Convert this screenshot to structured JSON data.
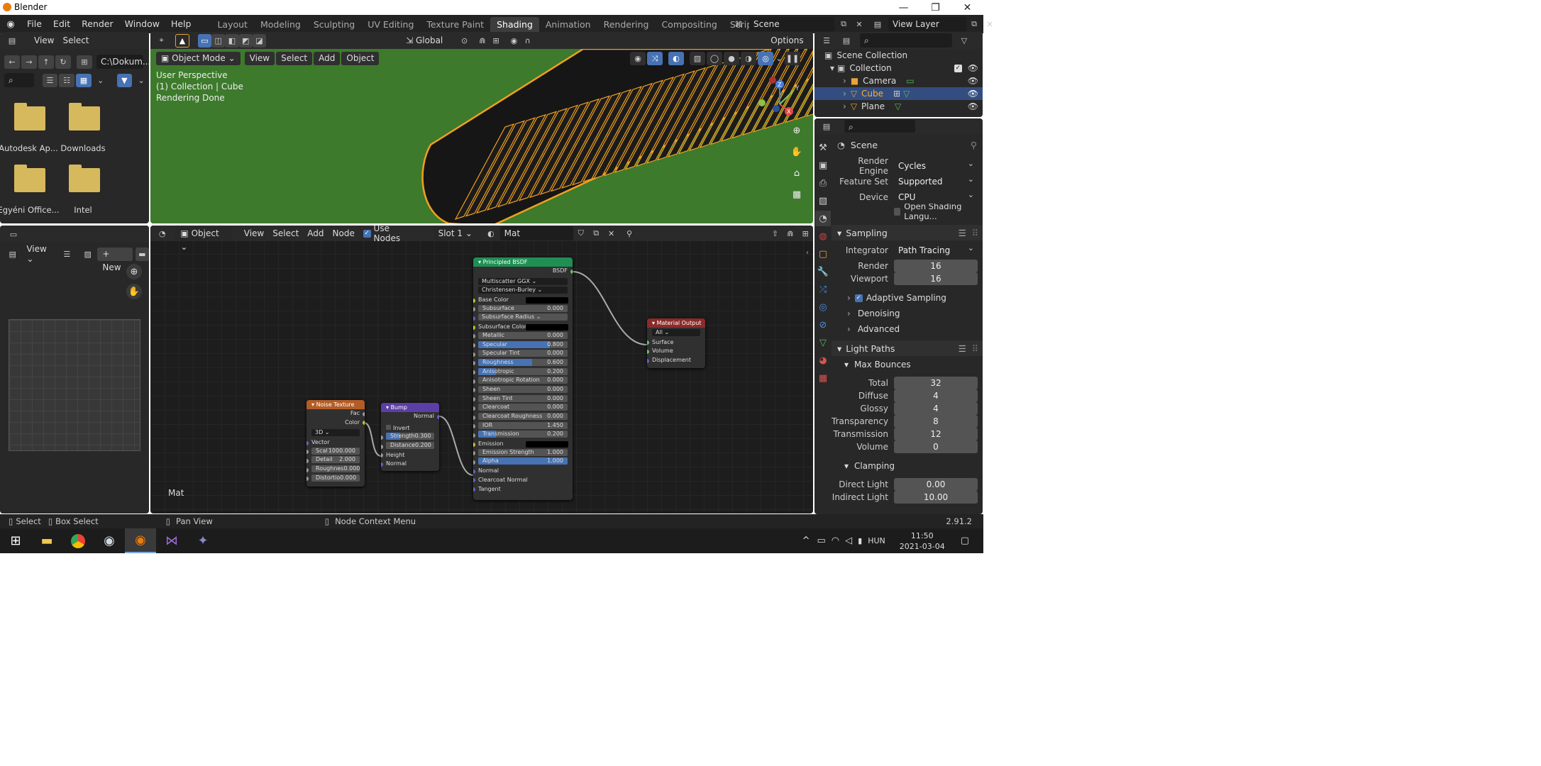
{
  "window": {
    "title": "Blender",
    "minimize": "—",
    "maximize": "❐",
    "close": "✕"
  },
  "topbar": {
    "menus": [
      "File",
      "Edit",
      "Render",
      "Window",
      "Help"
    ],
    "workspaces": [
      "Layout",
      "Modeling",
      "Sculpting",
      "UV Editing",
      "Texture Paint",
      "Shading",
      "Animation",
      "Rendering",
      "Compositing",
      "Scripting"
    ],
    "active_workspace": "Shading",
    "add_tab": "+",
    "scene": "Scene",
    "view_layer": "View Layer"
  },
  "file_browser": {
    "menus": [
      "View",
      "Select"
    ],
    "path": "C:\\Dokum...",
    "folders": [
      {
        "name": "Autodesk Ap..."
      },
      {
        "name": "Downloads"
      },
      {
        "name": "Egyéni Office..."
      },
      {
        "name": "Intel"
      }
    ]
  },
  "viewport": {
    "mode": "Object Mode",
    "menus": [
      "View",
      "Select",
      "Add",
      "Object"
    ],
    "transform": "Global",
    "options": "Options",
    "overlay_lines": [
      "User Perspective",
      "(1) Collection | Cube",
      "Rendering Done"
    ],
    "gizmo": {
      "x": "X",
      "y": "Y",
      "z": "Z"
    }
  },
  "image_editor": {
    "view": "View",
    "new": "New"
  },
  "node_editor": {
    "type": "Object",
    "menus": [
      "View",
      "Select",
      "Add",
      "Node"
    ],
    "use_nodes": "Use Nodes",
    "slot": "Slot 1",
    "material": "Mat",
    "corner_label": "Mat",
    "principled": {
      "title": "Principled BSDF",
      "output": "BSDF",
      "dist": "Multiscatter GGX",
      "sss_method": "Christensen-Burley",
      "base_color": "Base Color",
      "rows": [
        {
          "label": "Subsurface",
          "value": "0.000",
          "fill": 0
        },
        {
          "label": "Subsurface Radius",
          "value": "",
          "fill": 0,
          "drop": true
        },
        {
          "label": "Subsurface Color",
          "value": "",
          "fill": 0,
          "color": true
        },
        {
          "label": "Metallic",
          "value": "0.000",
          "fill": 0
        },
        {
          "label": "Specular",
          "value": "0.800",
          "fill": 0.8
        },
        {
          "label": "Specular Tint",
          "value": "0.000",
          "fill": 0
        },
        {
          "label": "Roughness",
          "value": "0.600",
          "fill": 0.6
        },
        {
          "label": "Anisotropic",
          "value": "0.200",
          "fill": 0.2
        },
        {
          "label": "Anisotropic Rotation",
          "value": "0.000",
          "fill": 0
        },
        {
          "label": "Sheen",
          "value": "0.000",
          "fill": 0
        },
        {
          "label": "Sheen Tint",
          "value": "0.000",
          "fill": 0
        },
        {
          "label": "Clearcoat",
          "value": "0.000",
          "fill": 0
        },
        {
          "label": "Clearcoat Roughness",
          "value": "0.000",
          "fill": 0
        },
        {
          "label": "IOR",
          "value": "1.450",
          "fill": 0
        },
        {
          "label": "Transmission",
          "value": "0.200",
          "fill": 0.2
        },
        {
          "label": "Emission",
          "value": "",
          "fill": 0,
          "color": true
        },
        {
          "label": "Emission Strength",
          "value": "1.000",
          "fill": 0
        },
        {
          "label": "Alpha",
          "value": "1.000",
          "fill": 1
        }
      ],
      "inputs": [
        "Normal",
        "Clearcoat Normal",
        "Tangent"
      ]
    },
    "output": {
      "title": "Material Output",
      "target": "All",
      "inputs": [
        "Surface",
        "Volume",
        "Displacement"
      ]
    },
    "noise": {
      "title": "Noise Texture",
      "outputs": [
        "Fac",
        "Color"
      ],
      "dim": "3D",
      "vector": "Vector",
      "rows": [
        {
          "label": "Scal",
          "value": "1000.000"
        },
        {
          "label": "Detail",
          "value": "2.000"
        },
        {
          "label": "Roughnes",
          "value": "0.000"
        },
        {
          "label": "Distortio",
          "value": "0.000"
        }
      ]
    },
    "bump": {
      "title": "Bump",
      "output": "Normal",
      "invert": "Invert",
      "rows": [
        {
          "label": "Strength",
          "value": "0.300",
          "fill": 0.3
        },
        {
          "label": "Distance",
          "value": "0.200",
          "fill": 0
        }
      ],
      "inputs": [
        "Height",
        "Normal"
      ]
    }
  },
  "outliner": {
    "items": [
      {
        "label": "Scene Collection"
      },
      {
        "label": "Collection"
      },
      {
        "label": "Camera"
      },
      {
        "label": "Cube"
      },
      {
        "label": "Plane"
      }
    ]
  },
  "properties": {
    "context": "Scene",
    "render_engine": {
      "label": "Render Engine",
      "value": "Cycles"
    },
    "feature_set": {
      "label": "Feature Set",
      "value": "Supported"
    },
    "device": {
      "label": "Device",
      "value": "CPU"
    },
    "osl": "Open Shading Langu...",
    "sampling": {
      "title": "Sampling",
      "integrator_label": "Integrator",
      "integrator": "Path Tracing",
      "render_label": "Render",
      "render": "16",
      "viewport_label": "Viewport",
      "viewport": "16",
      "adaptive": "Adaptive Sampling",
      "denoising": "Denoising",
      "advanced": "Advanced"
    },
    "light_paths": {
      "title": "Light Paths",
      "max_bounces": "Max Bounces",
      "rows": [
        {
          "label": "Total",
          "value": "32"
        },
        {
          "label": "Diffuse",
          "value": "4"
        },
        {
          "label": "Glossy",
          "value": "4"
        },
        {
          "label": "Transparency",
          "value": "8"
        },
        {
          "label": "Transmission",
          "value": "12"
        },
        {
          "label": "Volume",
          "value": "0"
        }
      ]
    },
    "clamping": {
      "title": "Clamping",
      "rows": [
        {
          "label": "Direct Light",
          "value": "0.00"
        },
        {
          "label": "Indirect Light",
          "value": "10.00"
        }
      ]
    }
  },
  "statusbar": {
    "select": "Select",
    "box_select": "Box Select",
    "pan_view": "Pan View",
    "context_menu": "Node Context Menu",
    "version": "2.91.2"
  },
  "taskbar": {
    "lang": "HUN",
    "time": "11:50",
    "date": "2021-03-04"
  }
}
